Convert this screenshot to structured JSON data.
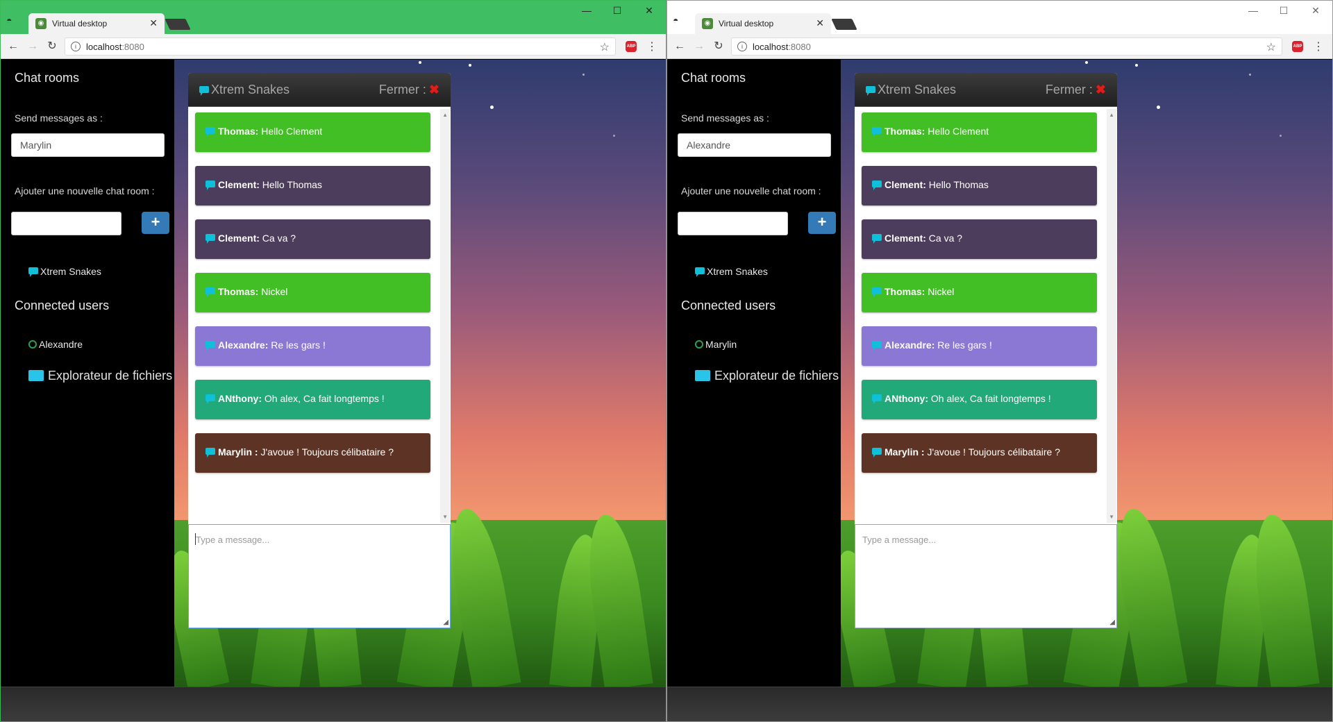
{
  "browser": {
    "tab_title": "Virtual desktop",
    "url_host": "localhost",
    "url_port": ":8080",
    "abp_label": "ABP"
  },
  "sidebar": {
    "chat_rooms_heading": "Chat rooms",
    "send_as_label": "Send messages as :",
    "add_room_label": "Ajouter une nouvelle chat room :",
    "add_button": "+",
    "room_name": "Xtrem Snakes",
    "connected_users_heading": "Connected users",
    "explorer_label": "Explorateur de fichiers"
  },
  "windows": [
    {
      "username": "Marylin",
      "connected_user": "Alexandre"
    },
    {
      "username": "Alexandre",
      "connected_user": "Marylin"
    }
  ],
  "chat": {
    "title": "Xtrem Snakes",
    "close_label": "Fermer :",
    "close_icon": "✖",
    "placeholder": "Type a message...",
    "messages": [
      {
        "author": "Thomas:",
        "text": " Hello Clement",
        "color": "#42bf24"
      },
      {
        "author": "Clement:",
        "text": " Hello Thomas",
        "color": "#4d3d5c"
      },
      {
        "author": "Clement:",
        "text": " Ca va ?",
        "color": "#4d3d5c"
      },
      {
        "author": "Thomas:",
        "text": " Nickel",
        "color": "#42bf24"
      },
      {
        "author": "Alexandre:",
        "text": " Re les gars !",
        "color": "#8a78d4"
      },
      {
        "author": "ANthony:",
        "text": " Oh alex, Ca fait longtemps !",
        "color": "#22a97a"
      },
      {
        "author": "Marylin :",
        "text": " J'avoue ! Toujours célibataire ?",
        "color": "#5c3324"
      }
    ]
  }
}
